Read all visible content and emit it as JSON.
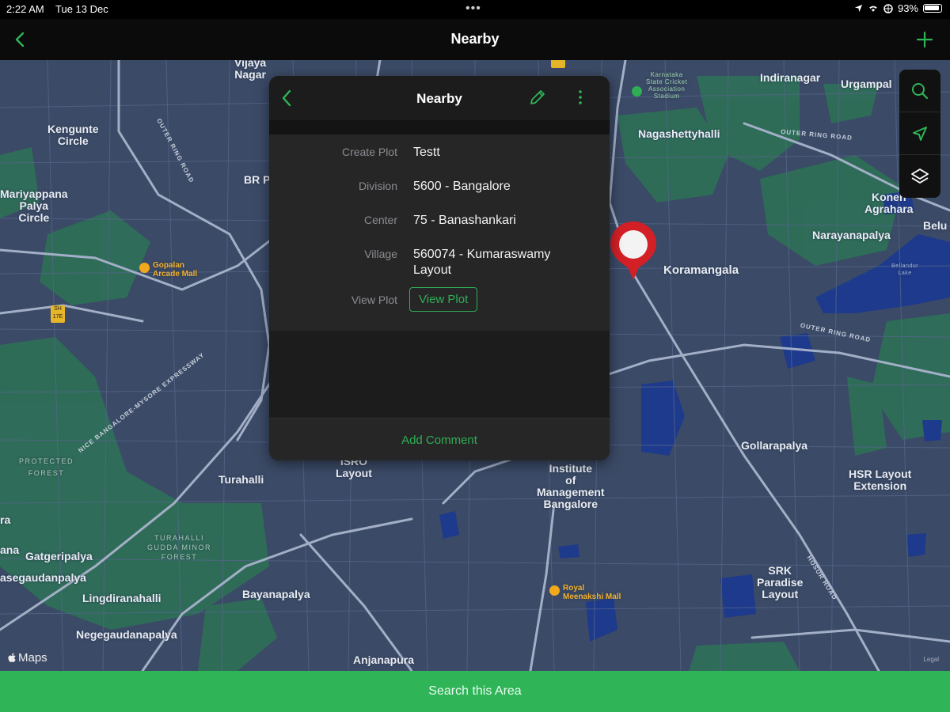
{
  "status": {
    "time": "2:22 AM",
    "date": "Tue 13 Dec",
    "battery": "93%"
  },
  "navbar": {
    "title": "Nearby"
  },
  "panel": {
    "title": "Nearby",
    "fields": [
      {
        "label": "Create Plot",
        "value": "Testt"
      },
      {
        "label": "Division",
        "value": "5600 - Bangalore"
      },
      {
        "label": "Center",
        "value": "75 - Banashankari"
      },
      {
        "label": "Village",
        "value": "560074 - Kumaraswamy Layout"
      }
    ],
    "view_plot": {
      "label": "View Plot",
      "button": "View Plot"
    },
    "add_comment": "Add Comment"
  },
  "map": {
    "attribution": "Maps",
    "legal": "Legal",
    "labels": {
      "vijaya": "Vijaya\nNagar",
      "kengunte": "Kengunte\nCircle",
      "mariyappana": "Mariyappana\nPalya\nCircle",
      "brp": "BR P",
      "indiranagar": "Indiranagar",
      "urgampal": "Urgampal",
      "nagashettyhalli": "Nagashettyhalli",
      "konen": "Konen\nAgrahara",
      "narayanapalya": "Narayanapalya",
      "belu": "Belu",
      "koramangala": "Koramangala",
      "gollarapalya": "Gollarapalya",
      "hsr": "HSR Layout\nExtension",
      "isro": "ISRO\nLayout",
      "iim": "Institute\nof\nManagement\nBangalore",
      "turahalli": "Turahalli",
      "gatgeripalya": "Gatgeripalya",
      "sanegauda": "asegaudanpalya",
      "ra": "ra",
      "ana": "ana",
      "lingdira": "Lingdiranahalli",
      "bayanapalya": "Bayanapalya",
      "negegauda": "Negegaudanapalya",
      "srk": "SRK\nParadise\nLayout",
      "anjanapura": "Anjanapura",
      "protected": "PROTECTED\nFOREST",
      "turahalli_forest": "TURAHALLI\nGUDDA MINOR\nFOREST",
      "gopalan": "Gopalan\nArcade Mall",
      "royal": "Royal\nMeenakshi Mall",
      "ksn": "Karnataka\nState Cricket\nAssociation\nStadium",
      "lake": "Bellandur\nLake",
      "road1": "OUTER RING ROAD",
      "road2": "NICE BANGALORE-MYSORE EXPRESSWAY",
      "road3": "OUTER RING ROAD",
      "road4": "OUTER RING ROAD",
      "road5": "HOSUR ROAD",
      "shield": "SH\n17E"
    }
  },
  "bottom": {
    "search_area": "Search this Area"
  },
  "colors": {
    "accent": "#2fb458",
    "pin": "#d31f26",
    "map_bg": "#3b4a66",
    "water": "#1d3a8f",
    "park": "#2f7a56"
  }
}
